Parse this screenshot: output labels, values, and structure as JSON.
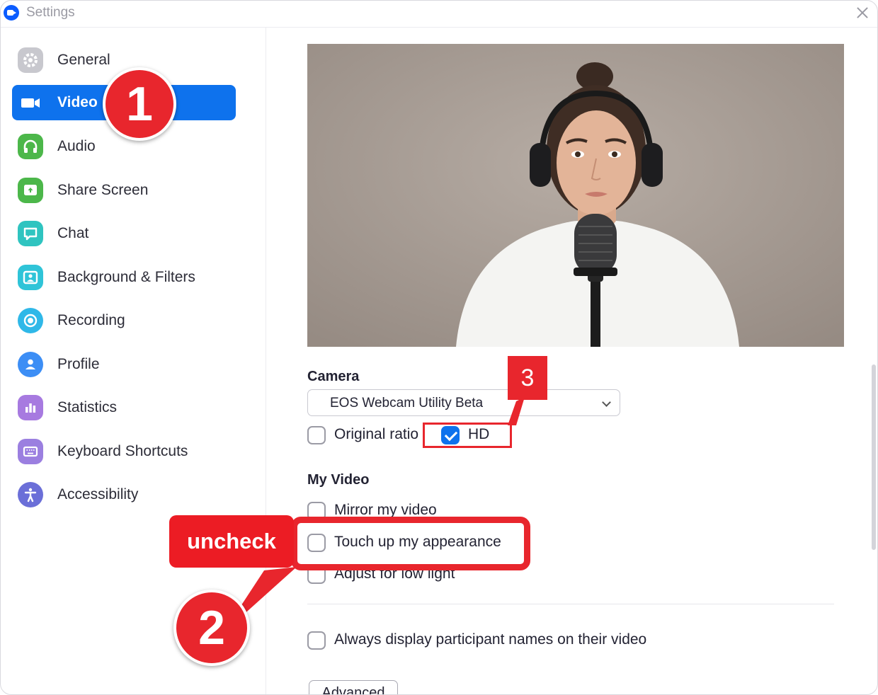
{
  "window": {
    "title": "Settings"
  },
  "sidebar": {
    "items": [
      {
        "label": "General",
        "icon": "gear-icon",
        "color": "#c8c8ce",
        "active": false
      },
      {
        "label": "Video",
        "icon": "video-camera-icon",
        "color": "#0e72ed",
        "active": true
      },
      {
        "label": "Audio",
        "icon": "headphones-icon",
        "color": "#4cb74a",
        "active": false
      },
      {
        "label": "Share Screen",
        "icon": "share-screen-icon",
        "color": "#4cb74a",
        "active": false
      },
      {
        "label": "Chat",
        "icon": "chat-bubble-icon",
        "color": "#2fc4c0",
        "active": false
      },
      {
        "label": "Background & Filters",
        "icon": "portrait-icon",
        "color": "#2fc4d8",
        "active": false
      },
      {
        "label": "Recording",
        "icon": "record-icon",
        "color": "#2fb8e8",
        "active": false
      },
      {
        "label": "Profile",
        "icon": "user-icon",
        "color": "#3c8ef5",
        "active": false
      },
      {
        "label": "Statistics",
        "icon": "bar-chart-icon",
        "color": "#a77ae0",
        "active": false
      },
      {
        "label": "Keyboard Shortcuts",
        "icon": "keyboard-icon",
        "color": "#9b7fe0",
        "active": false
      },
      {
        "label": "Accessibility",
        "icon": "accessibility-icon",
        "color": "#6b6fd8",
        "active": false
      }
    ]
  },
  "camera": {
    "heading": "Camera",
    "selected": "EOS Webcam Utility Beta",
    "original_ratio": {
      "label": "Original ratio",
      "checked": false
    },
    "hd": {
      "label": "HD",
      "checked": true
    }
  },
  "my_video": {
    "heading": "My Video",
    "mirror": {
      "label": "Mirror my video",
      "checked": false
    },
    "touch_up": {
      "label": "Touch up my appearance",
      "checked": false
    },
    "low_light": {
      "label": "Adjust for low light",
      "checked": false
    },
    "display_names": {
      "label": "Always display participant names on their video",
      "checked": false
    }
  },
  "advanced_label": "Advanced",
  "annotations": {
    "step1": "1",
    "step2": "2",
    "step3": "3",
    "uncheck": "uncheck",
    "accent": "#e8262d"
  }
}
